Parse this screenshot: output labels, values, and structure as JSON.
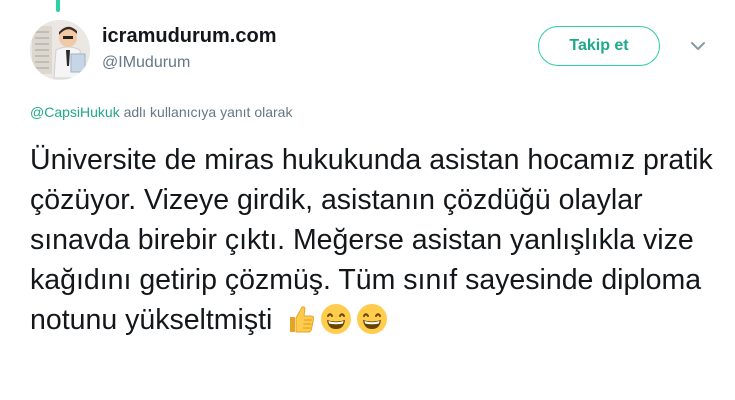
{
  "author": {
    "display_name": "icramudurum.com",
    "handle": "@IMudurum"
  },
  "follow_button": {
    "label": "Takip et"
  },
  "reply_context": {
    "mention": "@CapsiHukuk",
    "suffix": " adlı kullanıcıya yanıt olarak"
  },
  "tweet": {
    "text": "Üniversite de miras hukukunda asistan hocamız pratik çözüyor. Vizeye girdik, asistanın çözdüğü olaylar sınavda birebir çıktı. Meğerse asistan yanlışlıkla vize kağıdını getirip çözmüş. Tüm sınıf sayesinde diploma notunu yükseltmişti",
    "emojis": [
      "thumbs-up-icon",
      "grinning-face-icon",
      "grinning-face-icon"
    ]
  },
  "colors": {
    "accent": "#2bd0a4",
    "accent_text": "#1ea98a",
    "secondary_text": "#657786",
    "primary_text": "#14171a"
  }
}
